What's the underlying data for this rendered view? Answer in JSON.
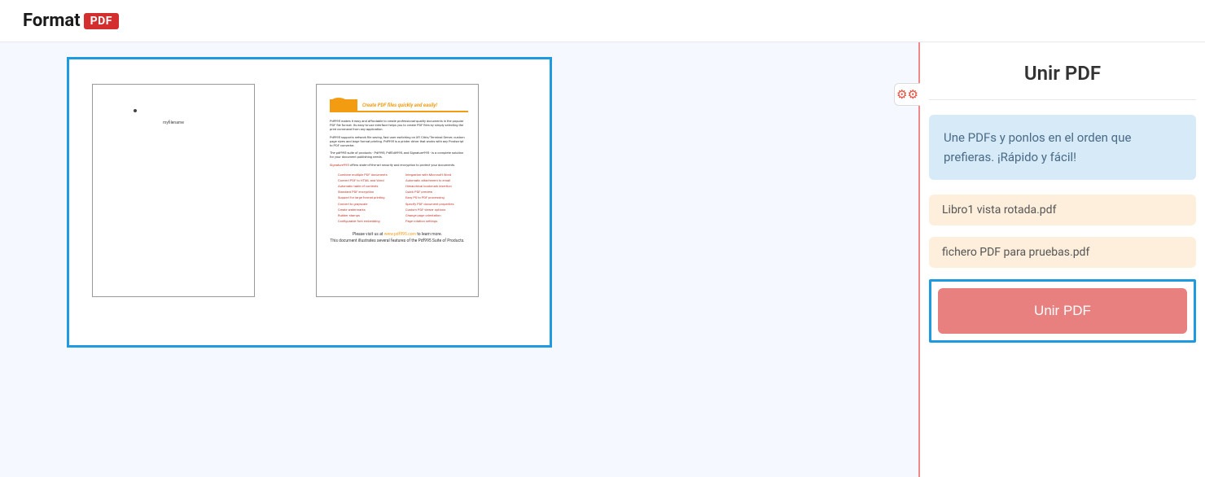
{
  "logo": {
    "text": "Format",
    "badge": "PDF"
  },
  "sidebar": {
    "title": "Unir PDF",
    "info_text": "Une PDFs y ponlos en el orden que prefieras. ¡Rápido y fácil!",
    "files": [
      "Libro1 vista rotada.pdf",
      "fichero PDF para pruebas.pdf"
    ],
    "action_label": "Unir PDF"
  },
  "thumbs": {
    "page2_tagline": "Create PDF files quickly and easily!",
    "page2_visit": "Please visit us at",
    "page2_url": "www.pdf995.com",
    "page2_visit_suffix": "to learn more.",
    "page2_footer": "This document illustrates several features of the Pdf995 Suite of Products."
  }
}
